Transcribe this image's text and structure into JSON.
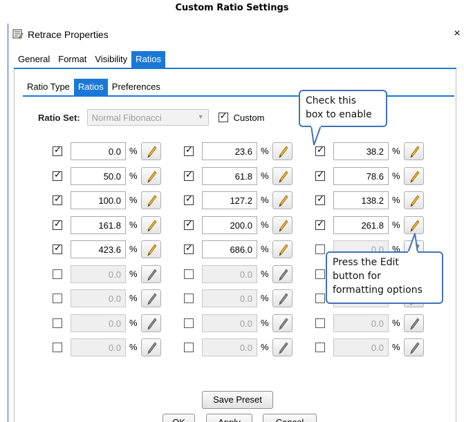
{
  "caption": "Custom Ratio Settings",
  "dialog": {
    "title": "Retrace Properties",
    "close_label": "×",
    "tabs": [
      {
        "label": "General",
        "active": false
      },
      {
        "label": "Format",
        "active": false
      },
      {
        "label": "Visibility",
        "active": false
      },
      {
        "label": "Ratios",
        "active": true
      }
    ],
    "subtabs": [
      {
        "label": "Ratio Type",
        "active": false
      },
      {
        "label": "Ratios",
        "active": true
      },
      {
        "label": "Preferences",
        "active": false
      }
    ],
    "ratio_set": {
      "label": "Ratio Set:",
      "selected": "Normal Fibonacci",
      "custom_label": "Custom",
      "custom_checked": true
    },
    "percent_symbol": "%",
    "ratios": [
      [
        "0.0",
        "23.6",
        "38.2"
      ],
      [
        "50.0",
        "61.8",
        "78.6"
      ],
      [
        "100.0",
        "127.2",
        "138.2"
      ],
      [
        "161.8",
        "200.0",
        "261.8"
      ],
      [
        "423.6",
        "686.0",
        "0.0"
      ],
      [
        "0.0",
        "0.0",
        "0.0"
      ],
      [
        "0.0",
        "0.0",
        "0.0"
      ],
      [
        "0.0",
        "0.0",
        "0.0"
      ],
      [
        "0.0",
        "0.0",
        "0.0"
      ]
    ],
    "enabled": [
      [
        true,
        true,
        true
      ],
      [
        true,
        true,
        true
      ],
      [
        true,
        true,
        true
      ],
      [
        true,
        true,
        true
      ],
      [
        true,
        true,
        false
      ],
      [
        false,
        false,
        false
      ],
      [
        false,
        false,
        false
      ],
      [
        false,
        false,
        false
      ],
      [
        false,
        false,
        false
      ]
    ],
    "save_preset_label": "Save Preset",
    "ok_label": "OK",
    "apply_label": "Apply",
    "cancel_label": "Cancel"
  },
  "callouts": {
    "checkbox_hint": "Check this box to enable",
    "checkbox_hint_line1": "Check this",
    "checkbox_hint_line2": "box to enable",
    "edit_hint_line1": "Press the Edit",
    "edit_hint_line2": "button for",
    "edit_hint_line3": "formatting options"
  },
  "colors": {
    "accent": "#1a78d6",
    "callout_border": "#3e72b9",
    "pencil_active": "#f0b429",
    "pencil_disabled": "#8a8a8a"
  },
  "icons": {
    "title": "properties-icon",
    "edit": "pencil-icon",
    "close": "close-icon",
    "dropdown": "chevron-down-icon"
  }
}
